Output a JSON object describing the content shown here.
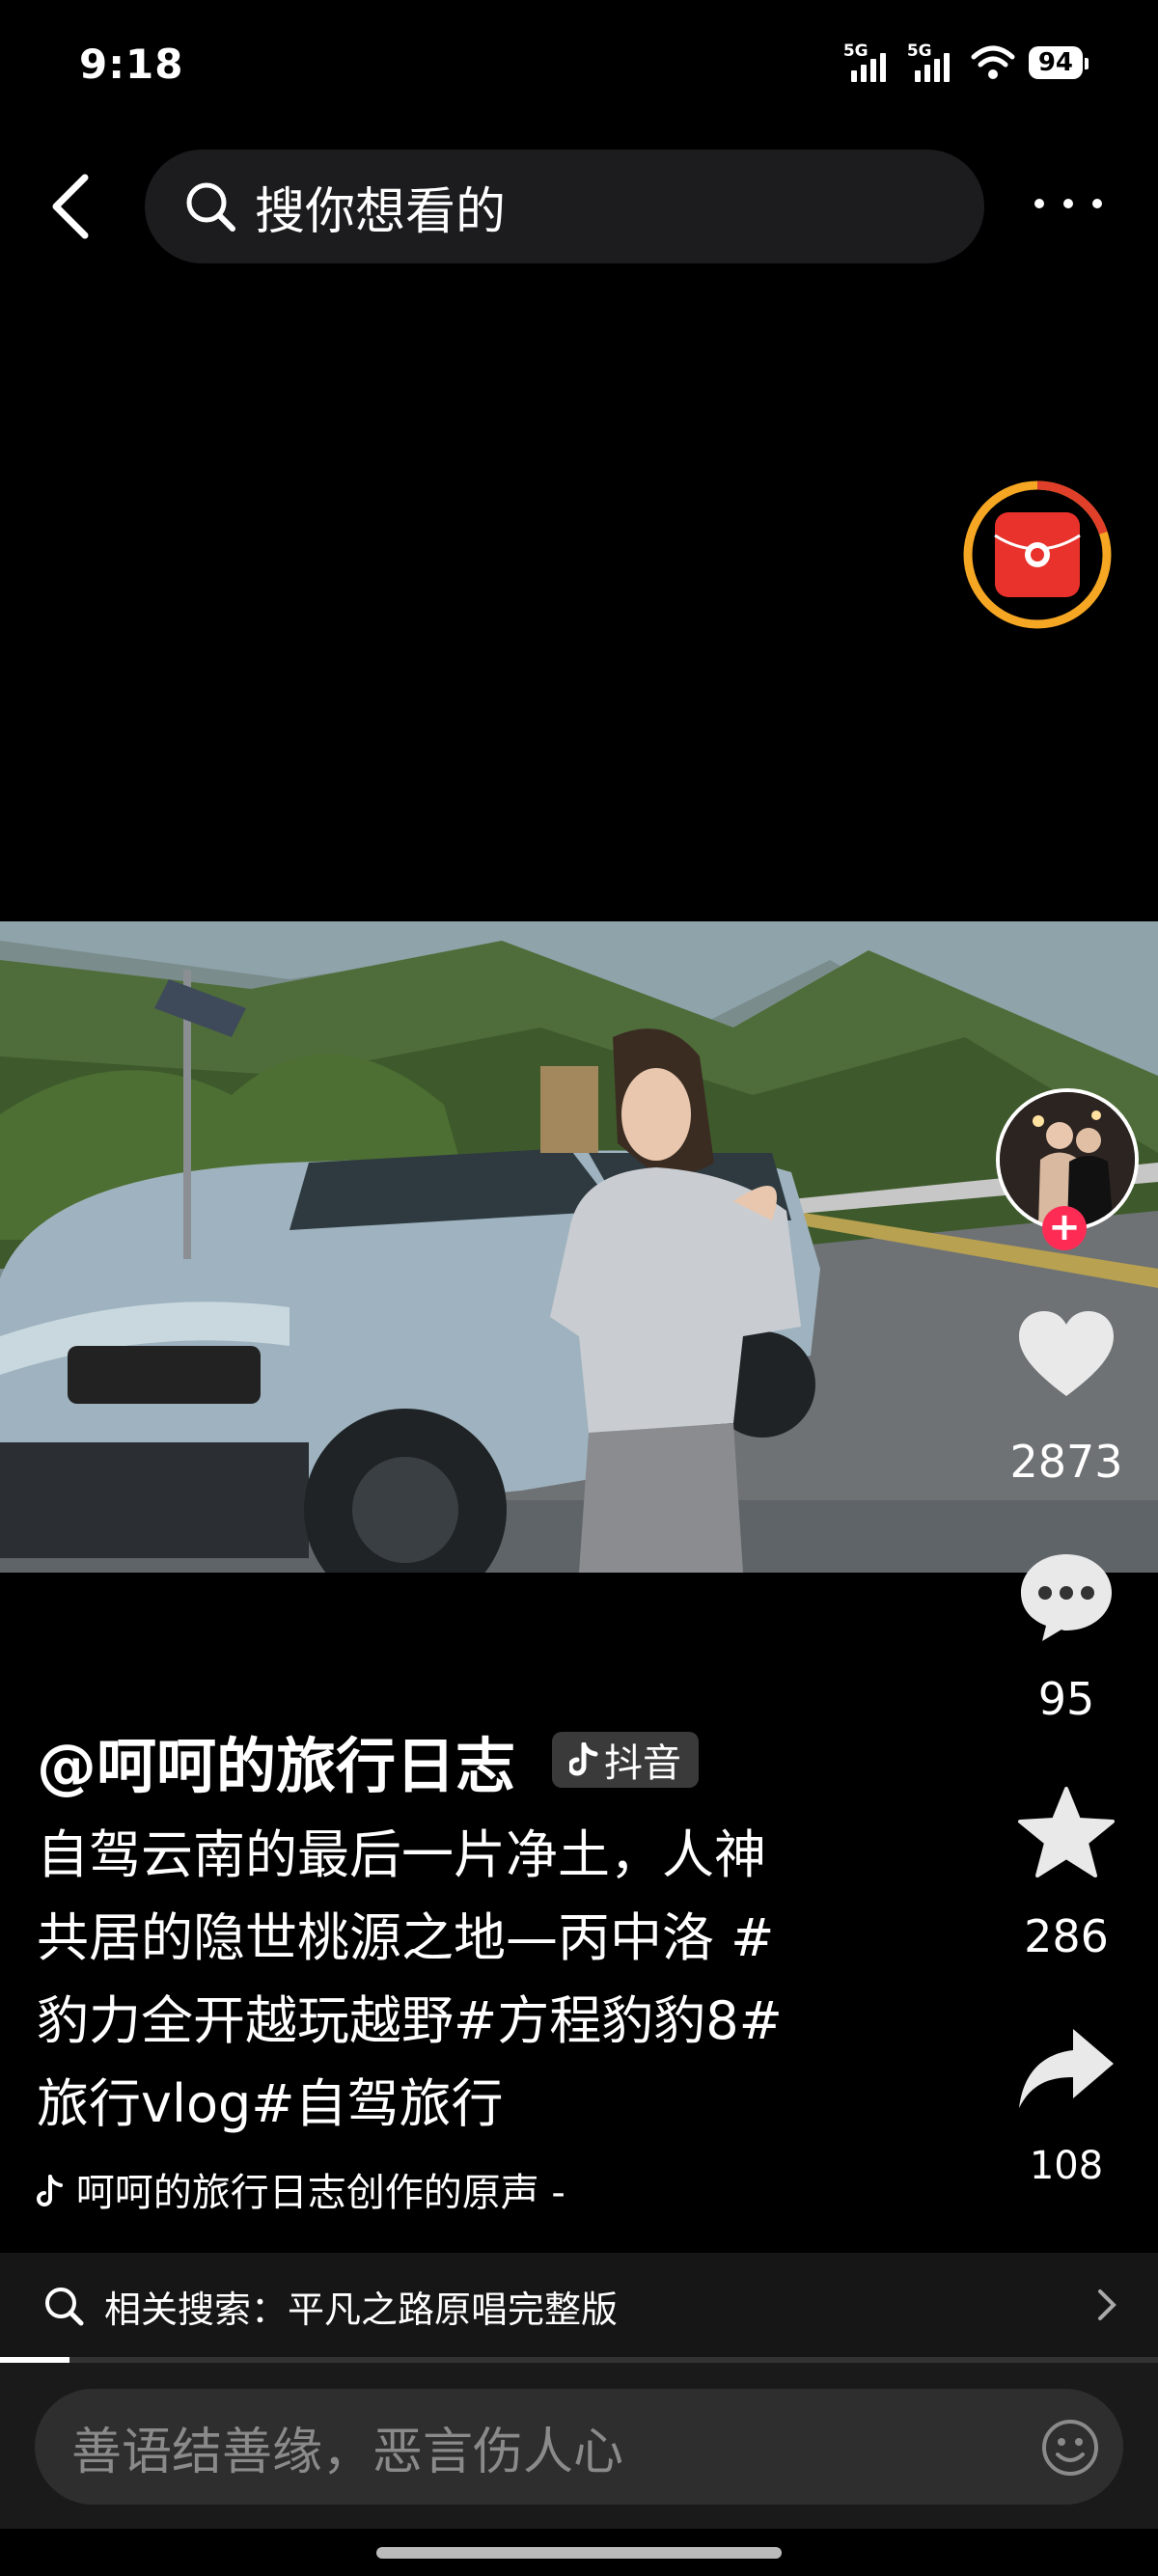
{
  "status": {
    "time": "9:18",
    "signal1": "5G",
    "signal2": "5G",
    "battery": "94"
  },
  "top": {
    "search_placeholder": "搜你想看的"
  },
  "rail": {
    "likes": "2873",
    "comments": "95",
    "favorites": "286",
    "shares": "108"
  },
  "post": {
    "author": "@呵呵的旅行日志",
    "platform_tag": "抖音",
    "caption_lines": [
      "自驾云南的最后一片净土，人神",
      "共居的隐世桃源之地—丙中洛 #",
      "豹力全开越玩越野#方程豹豹8#",
      "旅行vlog#自驾旅行"
    ],
    "music": "呵呵的旅行日志创作的原声 -"
  },
  "related": {
    "text": "相关搜索：平凡之路原唱完整版"
  },
  "progress": {
    "fraction": 0.06
  },
  "comment": {
    "placeholder": "善语结善缘，恶言伤人心"
  }
}
